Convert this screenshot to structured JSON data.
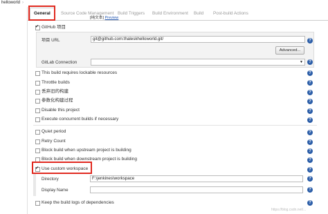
{
  "breadcrumb": {
    "project": "helloworld",
    "chevron": "›"
  },
  "tabs": [
    {
      "label": "General"
    },
    {
      "label": "Source Code Management"
    },
    {
      "label": "Build Triggers"
    },
    {
      "label": "Build Environment"
    },
    {
      "label": "Build"
    },
    {
      "label": "Post-build Actions"
    }
  ],
  "top_fragment": {
    "prefix": "[纯文本]",
    "link": "Preview"
  },
  "github": {
    "checkbox_label": "GitHub 项目",
    "url_label": "项目 URL",
    "url_value": "git@github.com:thaleskhelloworld.git/",
    "advanced_label": "Advanced...",
    "gitlab_label": "GitLab Connection"
  },
  "options": [
    {
      "label": "This build requires lockable resources",
      "checked": false
    },
    {
      "label": "Throttle builds",
      "checked": false
    },
    {
      "label": "丢弃旧的构建",
      "checked": false
    },
    {
      "label": "参数化构建过程",
      "checked": false
    },
    {
      "label": "Disable this project",
      "checked": false
    },
    {
      "label": "Execute concurrent builds if necessary",
      "checked": false
    }
  ],
  "advanced_options": [
    {
      "label": "Quiet period",
      "checked": false
    },
    {
      "label": "Retry Count",
      "checked": false
    },
    {
      "label": "Block build when upstream project is building",
      "checked": false
    },
    {
      "label": "Block build when downstream project is building",
      "checked": false
    },
    {
      "label": "Use custom workspace",
      "checked": true
    }
  ],
  "workspace": {
    "directory_label": "Directory",
    "directory_value": "F:\\jenkines\\workspace",
    "display_name_label": "Display Name",
    "display_name_value": ""
  },
  "keep_logs": {
    "label": "Keep the build logs of dependencies",
    "checked": false
  },
  "help_icon": "?",
  "watermark": "https://blog.csdn.net/...",
  "colors": {
    "highlight": "#e0281e",
    "help": "#2c5ea8",
    "link": "#2256b0"
  }
}
